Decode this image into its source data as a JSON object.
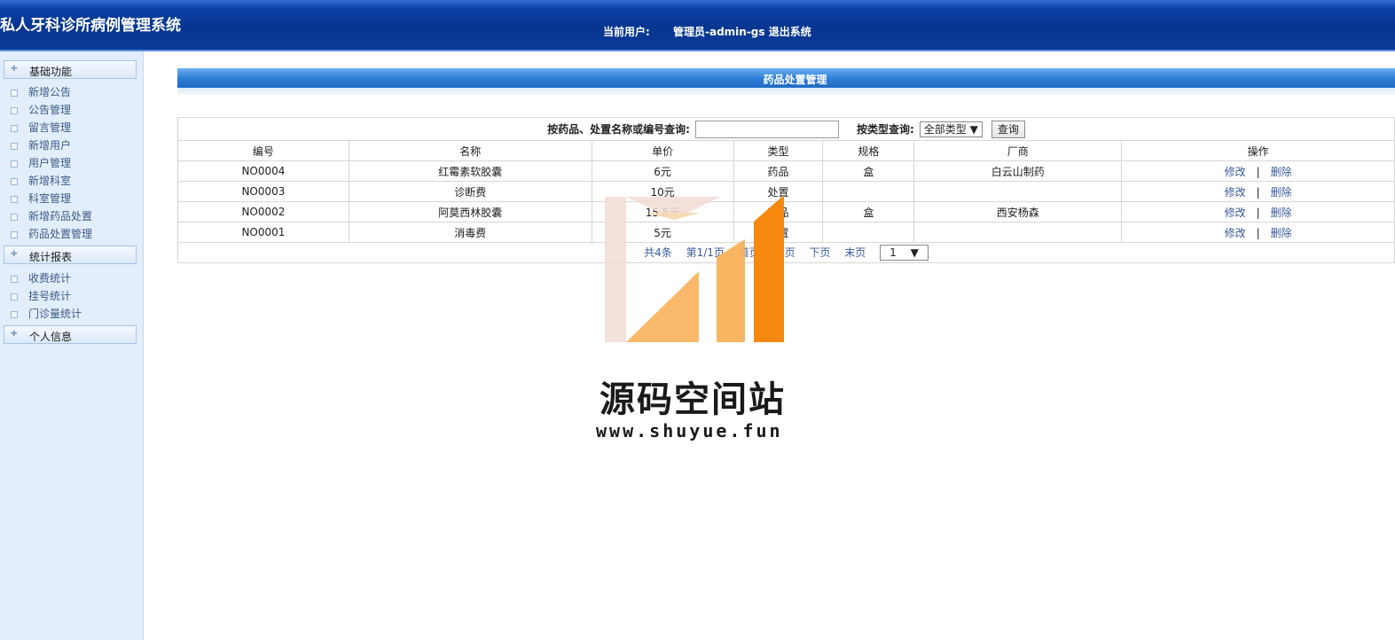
{
  "header": {
    "title": "私人牙科诊所病例管理系统",
    "user_label": "当前用户:",
    "user_name": "管理员-admin-gs",
    "logout": "退出系统"
  },
  "sidebar": {
    "groups": [
      {
        "label": "基础功能",
        "items": [
          "新增公告",
          "公告管理",
          "留言管理",
          "新增用户",
          "用户管理",
          "新增科室",
          "科室管理",
          "新增药品处置",
          "药品处置管理"
        ]
      },
      {
        "label": "统计报表",
        "items": [
          "收费统计",
          "挂号统计",
          "门诊量统计"
        ]
      },
      {
        "label": "个人信息",
        "items": []
      }
    ]
  },
  "main": {
    "panel_title": "药品处置管理",
    "search": {
      "label": "按药品、处置名称或编号查询:",
      "value": "",
      "type_label": "按类型查询:",
      "type_value": "全部类型",
      "button": "查询"
    },
    "columns": [
      "编号",
      "名称",
      "单价",
      "类型",
      "规格",
      "厂商",
      "操作"
    ],
    "rows": [
      {
        "id": "NO0004",
        "name": "红霉素软胶囊",
        "price": "6元",
        "type": "药品",
        "spec": "盒",
        "maker": "白云山制药"
      },
      {
        "id": "NO0003",
        "name": "诊断费",
        "price": "10元",
        "type": "处置",
        "spec": "",
        "maker": ""
      },
      {
        "id": "NO0002",
        "name": "阿莫西林胶囊",
        "price": "15.5元",
        "type": "药品",
        "spec": "盒",
        "maker": "西安杨森"
      },
      {
        "id": "NO0001",
        "name": "消毒费",
        "price": "5元",
        "type": "处置",
        "spec": "",
        "maker": ""
      }
    ],
    "op_edit": "修改",
    "op_sep": "|",
    "op_delete": "删除",
    "pager": {
      "total": "共4条",
      "page": "第1/1页",
      "first": "首页",
      "prev": "上页",
      "next": "下页",
      "last": "末页",
      "select": "1"
    }
  },
  "watermark": {
    "text": "源码空间站",
    "url": "www.shuyue.fun",
    "colors": {
      "light": "#f2dcd6",
      "mid": "#f9b15a",
      "dark": "#f7880f"
    }
  }
}
